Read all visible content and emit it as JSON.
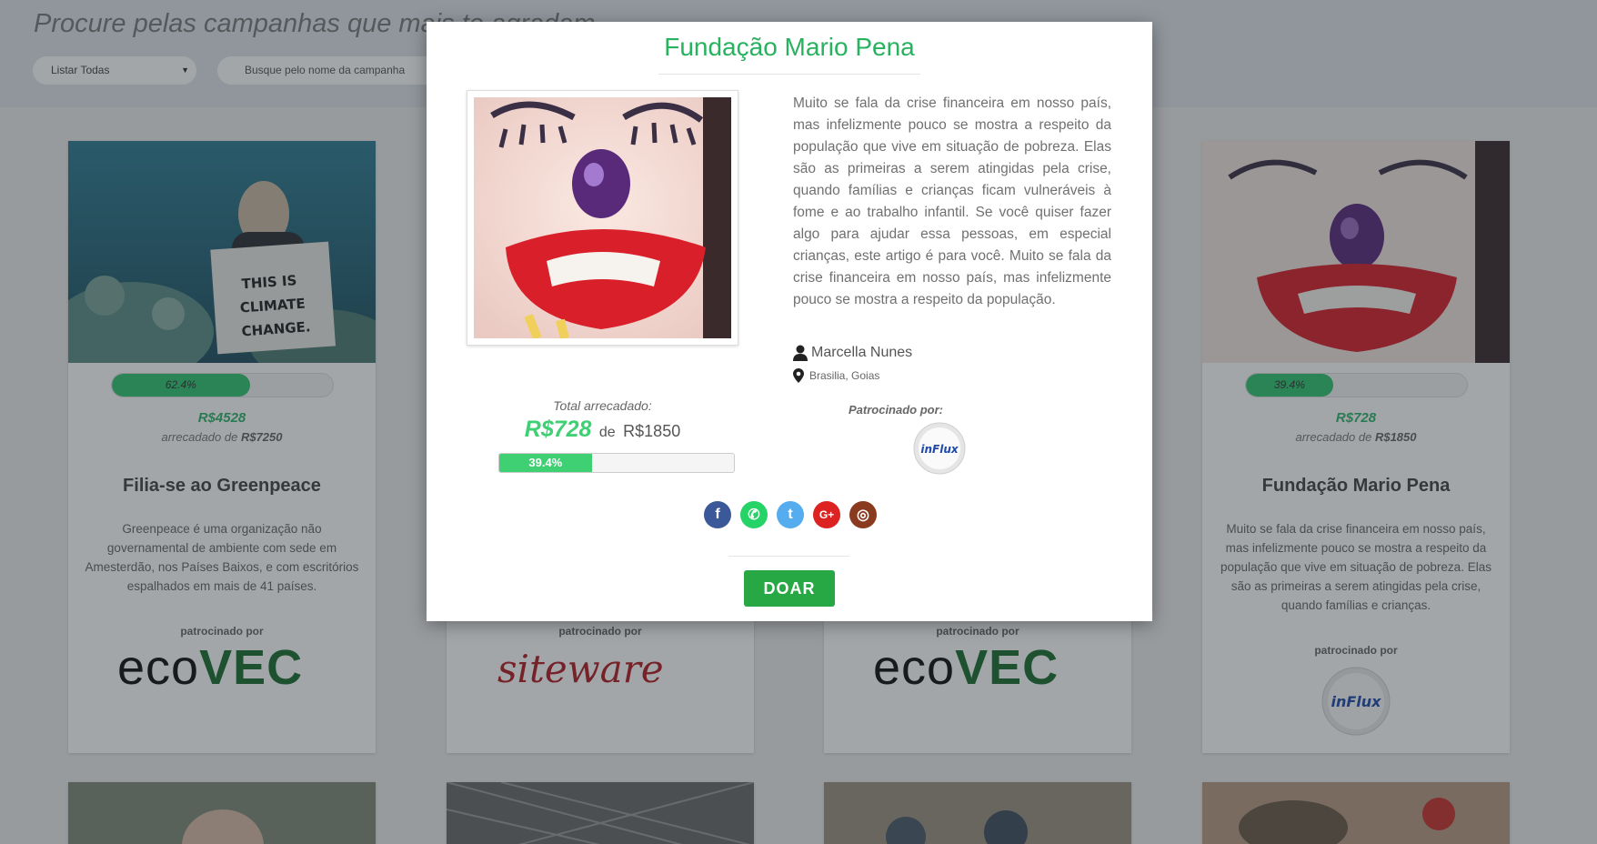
{
  "page": {
    "heading": "Procure pelas campanhas que mais te agradam",
    "filter_select": "Listar Todas",
    "search_placeholder": "Busque pelo nome da campanha"
  },
  "cards": [
    {
      "title": "Filia-se ao Greenpeace",
      "progress_label": "62.4%",
      "progress": 62.4,
      "raised": "R$4528",
      "goal_prefix": "arrecadado de",
      "goal": "R$7250",
      "description": "Greenpeace é uma organização não governamental de ambiente com sede em Amesterdão, nos Países Baixos, e com escritórios espalhados em mais de 41 países.",
      "sponsor_label": "patrocinado por",
      "sponsor_logo_a": "eco",
      "sponsor_logo_b": "VEC",
      "image_text": "THIS IS CLIMATE CHANGE."
    },
    {
      "sponsor_label": "patrocinado por",
      "sponsor_logo": "siteware"
    },
    {
      "sponsor_label": "patrocinado por",
      "sponsor_logo_a": "eco",
      "sponsor_logo_b": "VEC"
    },
    {
      "title": "Fundação Mario Pena",
      "progress_label": "39.4%",
      "progress": 39.4,
      "raised": "R$728",
      "goal_prefix": "arrecadado de",
      "goal": "R$1850",
      "description": "Muito se fala da crise financeira em nosso país, mas infelizmente pouco se mostra a respeito da população que vive em situação de pobreza. Elas são as primeiras a serem atingidas pela crise, quando famílias e crianças.",
      "sponsor_label": "patrocinado por",
      "sponsor_logo": "inFlux"
    }
  ],
  "modal": {
    "title": "Fundação Mario Pena",
    "description": "Muito se fala da crise financeira em nosso país, mas infelizmente pouco se mostra a respeito da população que vive em situação de pobreza. Elas são as primeiras a serem atingidas pela crise, quando famílias e crianças ficam vulneráveis à fome e ao trabalho infantil. Se você quiser fazer algo para ajudar essa pessoas, em especial crianças, este artigo é para você. Muito se fala da crise financeira em nosso país, mas infelizmente pouco se mostra a respeito da população.",
    "author": "Marcella Nunes",
    "location": "Brasilia, Goias",
    "total_label": "Total arrecadado:",
    "raised": "R$728",
    "de": "de",
    "goal": "R$1850",
    "progress_label": "39.4%",
    "progress": 39.4,
    "sponsor_label": "Patrocinado por:",
    "sponsor_logo": "inFlux",
    "socials": [
      {
        "name": "facebook-icon",
        "glyph": "f",
        "color": "#3b5998"
      },
      {
        "name": "whatsapp-icon",
        "glyph": "✆",
        "color": "#25d366"
      },
      {
        "name": "twitter-icon",
        "glyph": "t",
        "color": "#55acee"
      },
      {
        "name": "google-plus-icon",
        "glyph": "G+",
        "color": "#dd2222"
      },
      {
        "name": "instagram-icon",
        "glyph": "◎",
        "color": "#8a3a1e"
      }
    ],
    "donate_label": "DOAR"
  },
  "colors": {
    "accent_green": "#27b25f",
    "progress_green": "#3fd074",
    "button_green": "#27a844",
    "brand_red": "#b21d24"
  }
}
